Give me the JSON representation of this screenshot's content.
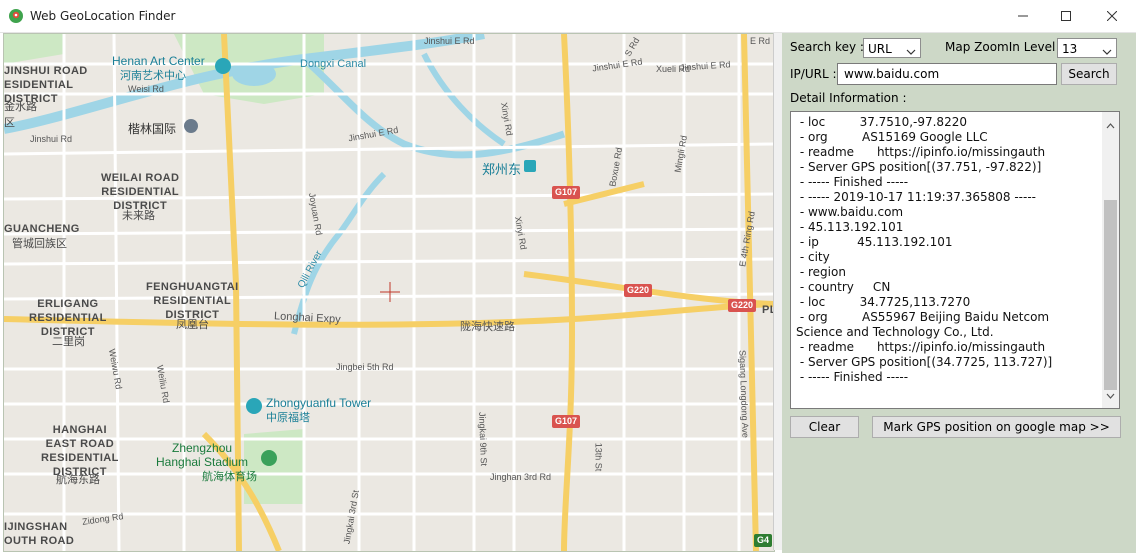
{
  "window": {
    "title": "Web GeoLocation Finder",
    "controls": [
      "minimize-icon",
      "maximize-icon",
      "close-icon"
    ]
  },
  "panel": {
    "search_key_label": "Search key :",
    "search_key_value": "URL",
    "zoom_label": "Map ZoomIn Level :",
    "zoom_value": "13",
    "ip_url_label": "IP/URL :",
    "ip_url_value": "www.baidu.com",
    "search_button": "Search",
    "detail_label": "Detail Information :",
    "detail_lines": [
      " - loc         37.7510,-97.8220",
      " - org         AS15169 Google LLC",
      " - readme      https://ipinfo.io/missingauth",
      " - Server GPS position[(37.751, -97.822)]",
      " - ----- Finished -----",
      " - ----- 2019-10-17 11:19:37.365808 -----",
      " - www.baidu.com",
      " - 45.113.192.101",
      " - ip          45.113.192.101",
      " - city",
      " - region",
      " - country     CN",
      " - loc         34.7725,113.7270",
      " - org         AS55967 Beijing Baidu Netcom Science and Technology Co., Ltd.",
      " - readme      https://ipinfo.io/missingauth",
      " - Server GPS position[(34.7725, 113.727)]",
      " - ----- Finished -----"
    ],
    "clear_button": "Clear",
    "mark_button": "Mark GPS position on google map >>"
  },
  "map": {
    "districts": [
      {
        "id": "jinshui-road",
        "text": "JINSHUI ROAD\nESIDENTIAL\nDISTRICT"
      },
      {
        "id": "jinshui-cn",
        "text": "金水路\n区"
      },
      {
        "id": "weilai",
        "text": "WEILAI ROAD\nRESIDENTIAL\nDISTRICT"
      },
      {
        "id": "weilai-cn",
        "text": "未来路"
      },
      {
        "id": "guancheng",
        "text": "GUANCHENG"
      },
      {
        "id": "guancheng-cn",
        "text": "管城回族区"
      },
      {
        "id": "erligang",
        "text": "ERLIGANG\nRESIDENTIAL\nDISTRICT"
      },
      {
        "id": "erligang-cn",
        "text": "二里岗"
      },
      {
        "id": "fenghuangtai",
        "text": "FENGHUANGTAI\nRESIDENTIAL\nDISTRICT"
      },
      {
        "id": "fenghuangtai-cn",
        "text": "凤凰台"
      },
      {
        "id": "hanghai",
        "text": "HANGHAI\nEAST ROAD\nRESIDENTIAL\nDISTRICT"
      },
      {
        "id": "hanghai-cn",
        "text": "航海东路"
      },
      {
        "id": "jingshan",
        "text": "IJINGSHAN\nOUTH ROAD"
      }
    ],
    "pois": [
      {
        "id": "henan-art",
        "text": "Henan Art Center",
        "cn": "河南艺术中心"
      },
      {
        "id": "jialin",
        "text": "楷林国际"
      },
      {
        "id": "zhengzhou-east",
        "text": "郑州东"
      },
      {
        "id": "zhongyuanfu",
        "text": "Zhongyuanfu Tower",
        "cn": "中原福塔"
      },
      {
        "id": "hanghai-stadium",
        "text": "Zhengzhou\nHanghai Stadium",
        "cn": "航海体育场"
      }
    ],
    "roads": [
      {
        "id": "dongxi-canal",
        "text": "Dongxi Canal"
      },
      {
        "id": "longhai-expy",
        "text": "Longhai Expy"
      },
      {
        "id": "longhai-cn",
        "text": "陇海快速路"
      },
      {
        "id": "qili-river",
        "text": "Qili River"
      },
      {
        "id": "weisi-rd",
        "text": "Weisi Rd"
      },
      {
        "id": "jinshui-rd",
        "text": "Jinshui Rd"
      },
      {
        "id": "jinshui-e-rd-1",
        "text": "Jinshui E Rd"
      },
      {
        "id": "jinshui-e-rd-2",
        "text": "Jinshui E Rd"
      },
      {
        "id": "jinshui-e-rd-3",
        "text": "Jinshui E Rd"
      },
      {
        "id": "xueli-rd",
        "text": "Xueli Rd"
      },
      {
        "id": "xinyi-rd-1",
        "text": "Xinyi Rd"
      },
      {
        "id": "xinyi-rd-2",
        "text": "Xinyi Rd"
      },
      {
        "id": "joyuan-rd",
        "text": "Joyuan Rd"
      },
      {
        "id": "boxue-rd",
        "text": "Boxue Rd"
      },
      {
        "id": "mingli-rd",
        "text": "Mingli Rd"
      },
      {
        "id": "e4th-ring",
        "text": "E 4th Ring Rd"
      },
      {
        "id": "jingbei-5th",
        "text": "Jingbei 5th Rd"
      },
      {
        "id": "jingkai-9th",
        "text": "Jingkai 9th St"
      },
      {
        "id": "jinghan-3rd",
        "text": "Jinghan 3rd Rd"
      },
      {
        "id": "jingkai-3rd",
        "text": "Jingkai 3rd St"
      },
      {
        "id": "13th-st",
        "text": "13th St"
      },
      {
        "id": "sigang",
        "text": "Sigang Longdong Ave"
      },
      {
        "id": "zidong-rd",
        "text": "Zidong Rd"
      },
      {
        "id": "weiwu-rd",
        "text": "Weiwu Rd"
      },
      {
        "id": "weiliu-rd",
        "text": "Weiliu Rd"
      },
      {
        "id": "s-rd",
        "text": "S Rd"
      },
      {
        "id": "e-rd",
        "text": "E Rd"
      },
      {
        "id": "jinshui-e-top",
        "text": "Jinshui E Rd"
      }
    ],
    "shields": [
      "G107",
      "G220",
      "G220",
      "G107",
      "G4"
    ],
    "pl": "PL"
  },
  "colors": {
    "panel_bg": "#cdd8c7",
    "map_bg": "#ebe8e2",
    "highway": "#f6cf65",
    "water": "#9fd5e6",
    "park": "#c8e6c0"
  }
}
